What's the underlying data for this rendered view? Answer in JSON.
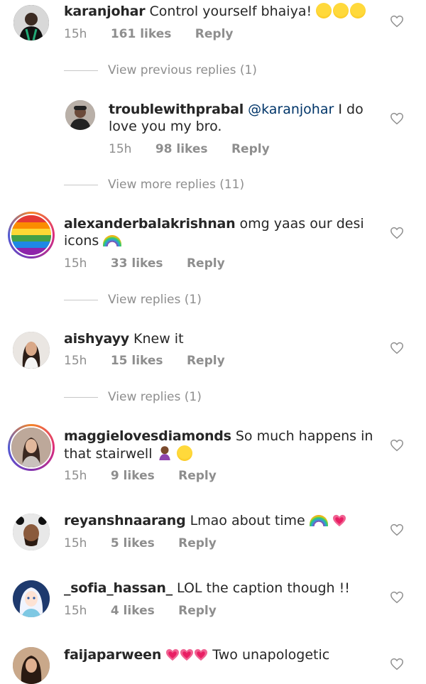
{
  "comments": [
    {
      "user": "karanjohar",
      "text": "Control yourself bhaiya!",
      "time": "15h",
      "likes": "161 likes",
      "reply": "Reply"
    },
    {
      "user": "troublewithprabal",
      "mention": "@karanjohar",
      "text": "I do love you my bro.",
      "time": "15h",
      "likes": "98 likes",
      "reply": "Reply"
    },
    {
      "user": "alexanderbalakrishnan",
      "text": "omg yaas our desi icons",
      "time": "15h",
      "likes": "33 likes",
      "reply": "Reply"
    },
    {
      "user": "aishyayy",
      "text": "Knew it",
      "time": "15h",
      "likes": "15 likes",
      "reply": "Reply"
    },
    {
      "user": "maggielovesdiamonds",
      "text": "So much happens in that stairwell",
      "time": "15h",
      "likes": "9 likes",
      "reply": "Reply"
    },
    {
      "user": "reyanshnaarang",
      "text": "Lmao about time",
      "time": "15h",
      "likes": "5 likes",
      "reply": "Reply"
    },
    {
      "user": "_sofia_hassan_",
      "text": "LOL the caption though !!",
      "time": "15h",
      "likes": "4 likes",
      "reply": "Reply"
    },
    {
      "user": "faijaparween",
      "text": "Two unapologetic"
    }
  ],
  "view_links": {
    "previous": "View previous replies (1)",
    "more": "View more replies (11)",
    "alex": "View replies (1)",
    "aishy": "View replies (1)"
  },
  "icons": {
    "like": "heart-outline-icon"
  }
}
